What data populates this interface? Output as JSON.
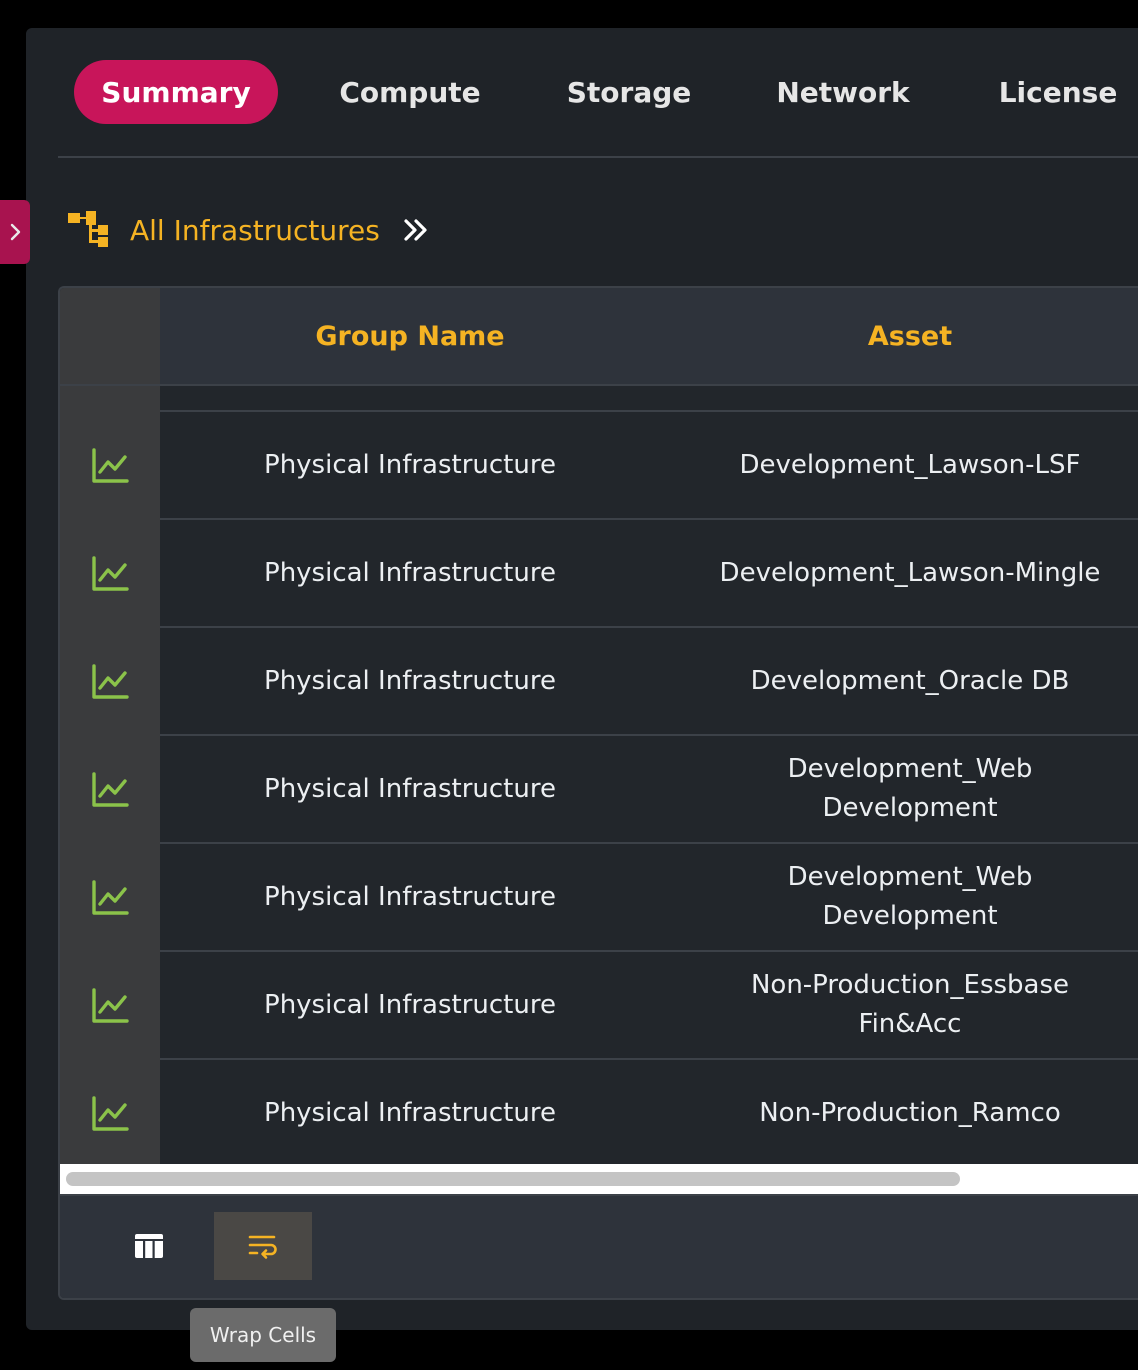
{
  "tabs": [
    {
      "label": "Summary",
      "active": true
    },
    {
      "label": "Compute",
      "active": false
    },
    {
      "label": "Storage",
      "active": false
    },
    {
      "label": "Network",
      "active": false
    },
    {
      "label": "License",
      "active": false
    }
  ],
  "breadcrumb": {
    "icon": "tree-structure-icon",
    "label": "All Infrastructures",
    "chevron": "double-chevron-right-icon"
  },
  "table": {
    "columns": [
      "Group Name",
      "Asset"
    ],
    "row_icon": "trend-chart-icon",
    "rows": [
      {
        "group": "Physical Infrastructure",
        "asset": "Development_Lawson-LSF"
      },
      {
        "group": "Physical Infrastructure",
        "asset": "Development_Lawson-Mingle"
      },
      {
        "group": "Physical Infrastructure",
        "asset": "Development_Oracle DB"
      },
      {
        "group": "Physical Infrastructure",
        "asset": "Development_Web Development"
      },
      {
        "group": "Physical Infrastructure",
        "asset": "Development_Web Development"
      },
      {
        "group": "Physical Infrastructure",
        "asset": "Non-Production_Essbase Fin&Acc"
      },
      {
        "group": "Physical Infrastructure",
        "asset": "Non-Production_Ramco"
      }
    ]
  },
  "footer": {
    "buttons": [
      {
        "icon": "table-columns-icon",
        "active": false
      },
      {
        "icon": "wrap-text-icon",
        "active": true
      }
    ],
    "tooltip": "Wrap Cells"
  },
  "colors": {
    "accent": "#c8155a",
    "highlight": "#f5b323",
    "chart_icon": "#8bc34a",
    "background": "#1f2328"
  }
}
